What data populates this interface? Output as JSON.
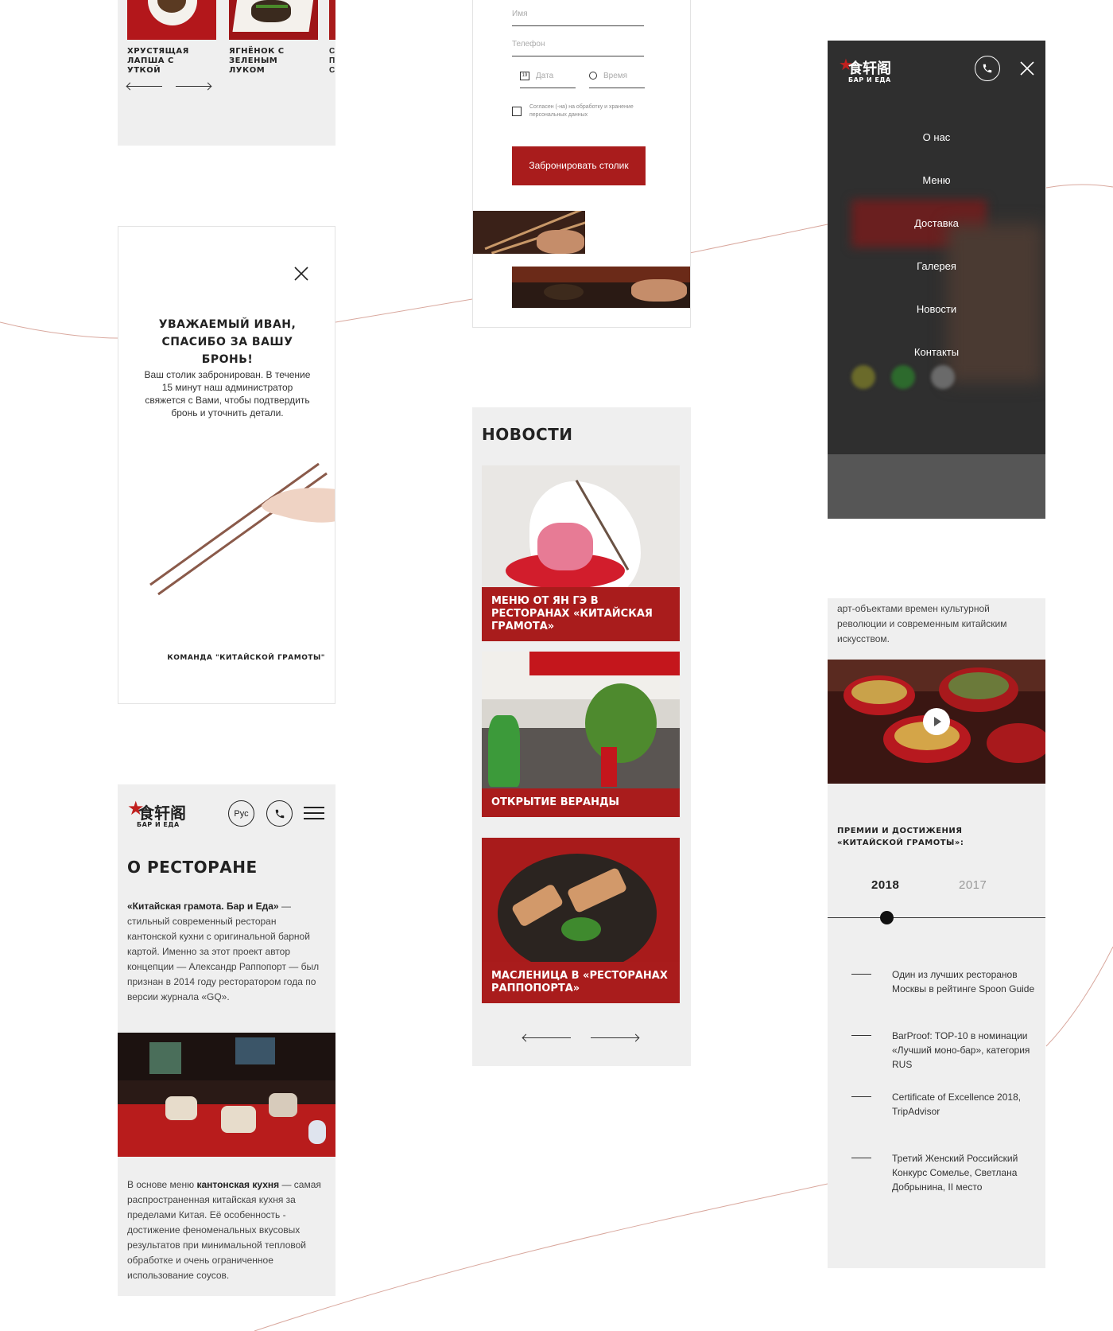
{
  "colors": {
    "accent": "#a91c1c",
    "panel_gray": "#efefef",
    "menu_dark": "#3a3a3a"
  },
  "panel_dishes": {
    "dishes": [
      {
        "name": "хрустящая лапша с уткой"
      },
      {
        "name": "ягнёнок с зеленым луком"
      }
    ],
    "icons": [
      "arrow-left-icon",
      "arrow-right-icon"
    ]
  },
  "panel_thanks": {
    "heading": "Уважаемый Иван, спасибо за вашу бронь!",
    "text": "Ваш столик забронирован. В течение 15 минут наш администратор свяжется с Вами, чтобы подтвердить бронь и уточнить детали.",
    "signature": "команда \"китайской грамоты\"",
    "icons": [
      "close-icon",
      "chopsticks-illustration"
    ]
  },
  "panel_about": {
    "logo_mark": "食轩阁",
    "logo_sub": "бар и еда",
    "lang_button": "Рус",
    "title": "О ресторане",
    "intro_bold": "«Китайская грамота. Бар и Еда»",
    "intro_rest": " — стильный современный ресторан кантонской кухни с оригинальной барной картой. Именно за этот проект автор концепции — Александр Раппопорт — был признан в 2014 году ресторатором года по версии журнала «GQ».",
    "text2_a": "В основе меню ",
    "text2_bold": "кантонская кухня",
    "text2_b": " — самая распространенная китайская кухня за пределами Китая. Её особенность - достижение феноменальных вкусовых результатов при минимальной тепловой обработке и очень ограниченное использование соусов.",
    "icons": [
      "phone-icon",
      "hamburger-menu-icon",
      "star-logo-icon"
    ]
  },
  "panel_booking": {
    "name_placeholder": "Имя",
    "phone_placeholder": "Телефон",
    "date_placeholder": "Дата",
    "time_placeholder": "Время",
    "consent": "Согласен (-на) на обработку и хранение персональных данных",
    "submit": "Забронировать столик",
    "icons": [
      "calendar-icon",
      "clock-icon",
      "checkbox-icon"
    ]
  },
  "panel_news": {
    "title": "Новости",
    "items": [
      {
        "caption": "Меню от Ян Гэ в ресторанах «Китайская грамота»"
      },
      {
        "caption": "Открытие веранды"
      },
      {
        "caption": "Масленица в «ресторанах Раппопорта»"
      }
    ],
    "icons": [
      "arrow-left-icon",
      "arrow-right-icon"
    ]
  },
  "panel_menu": {
    "logo_mark": "食轩阁",
    "logo_sub": "бар и еда",
    "items": [
      "О нас",
      "Меню",
      "Доставка",
      "Галерея",
      "Новости",
      "Контакты"
    ],
    "icons": [
      "phone-icon",
      "close-icon",
      "social-icon"
    ]
  },
  "panel_awards": {
    "intro": "арт-объектами времен культурной революции и современным китайским искусством.",
    "title": "Премии и достижения «Китайской грамоты»:",
    "years": [
      "2018",
      "2017"
    ],
    "selected_year": "2018",
    "awards": [
      "Один из лучших ресторанов Москвы в рейтинге Spoon Guide",
      "BarProof: TOP-10 в номинации «Лучший моно-бар», категория RUS",
      "Certificate of Excellence 2018, TripAdvisor",
      "Третий Женский Российский Конкурс Сомелье, Светлана Добрынина, II место"
    ],
    "icons": [
      "play-icon"
    ]
  }
}
